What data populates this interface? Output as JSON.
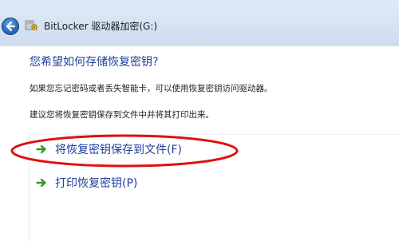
{
  "window": {
    "title": "BitLocker 驱动器加密(G:)"
  },
  "content": {
    "heading": "您希望如何存储恢复密钥?",
    "paragraph1": "如果您忘记密码或者丢失智能卡，可以使用恢复密钥访问驱动器。",
    "paragraph2": "建议您将恢复密钥保存到文件中并将其打印出来。"
  },
  "options": [
    {
      "label": "将恢复密钥保存到文件(F)"
    },
    {
      "label": "打印恢复密钥(P)"
    }
  ],
  "colors": {
    "heading": "#1f3f9e",
    "option_label": "#1f3f9e",
    "arrow": "#2e9a2e",
    "annotation": "#e01010",
    "titlebar": "#d5e3f3"
  },
  "icons": {
    "back": "back-arrow-icon",
    "app": "bitlocker-key-icon",
    "option_arrow": "green-arrow-icon"
  }
}
